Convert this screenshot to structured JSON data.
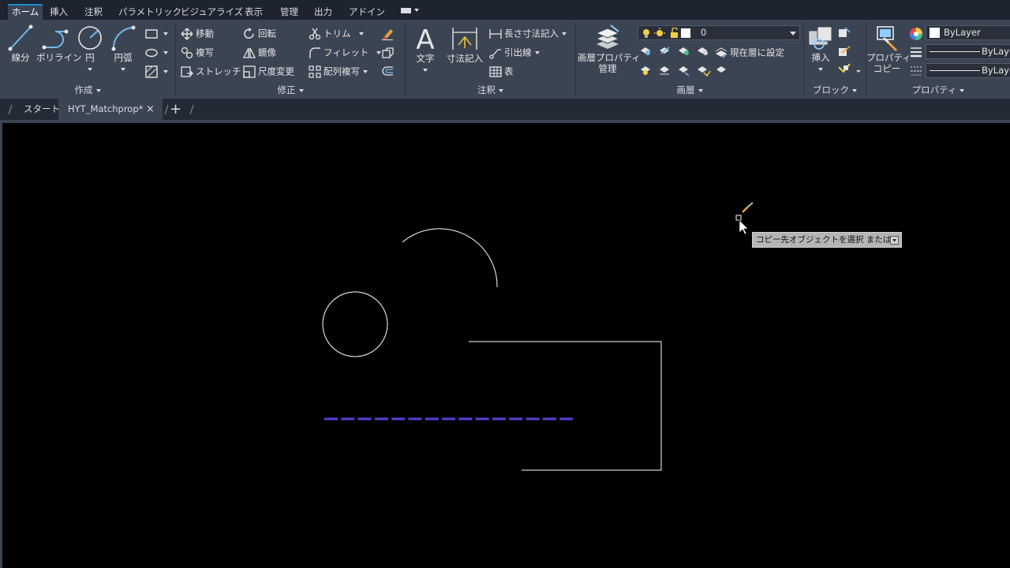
{
  "ribbon_tabs": [
    "ホーム",
    "挿入",
    "注釈",
    "パラメトリック",
    "ビジュアライズ",
    "表示",
    "管理",
    "出力",
    "アドイン"
  ],
  "panels": {
    "create": {
      "title": "作成",
      "line": "線分",
      "polyline": "ポリライン",
      "circle": "円",
      "arc": "円弧"
    },
    "modify": {
      "title": "修正",
      "move": "移動",
      "rotate": "回転",
      "trim": "トリム",
      "copy": "複写",
      "mirror": "鏡像",
      "fillet": "フィレット",
      "stretch": "ストレッチ",
      "scale": "尺度変更",
      "array": "配列複写"
    },
    "annotation": {
      "title": "注釈",
      "text": "文字",
      "dimension": "寸法記入",
      "linear": "長さ寸法記入",
      "leader": "引出線",
      "table": "表"
    },
    "layers": {
      "title": "画層",
      "properties_line1": "画層プロパティ",
      "properties_line2": "管理",
      "current_layer": "0",
      "make_current": "現在層に設定"
    },
    "block": {
      "title": "ブロック",
      "insert": "挿入"
    },
    "properties": {
      "title": "プロパティ",
      "match_line1": "プロパティ",
      "match_line2": "コピー",
      "color": "ByLayer",
      "linetype": "ByLayer",
      "lineweight": "ByLayer"
    }
  },
  "file_tabs": {
    "start": "スタート",
    "active": "HYT_Matchprop*",
    "close": "×",
    "new": "+"
  },
  "tooltip": {
    "text": "コピー先オブジェクトを選択 または"
  },
  "colors": {
    "accent": "#1a8ed1",
    "ribbon_bg": "#3b4453",
    "canvas_bg": "#000000",
    "dashed_line": "#5b3fd9",
    "geometry": "#ffffff"
  }
}
